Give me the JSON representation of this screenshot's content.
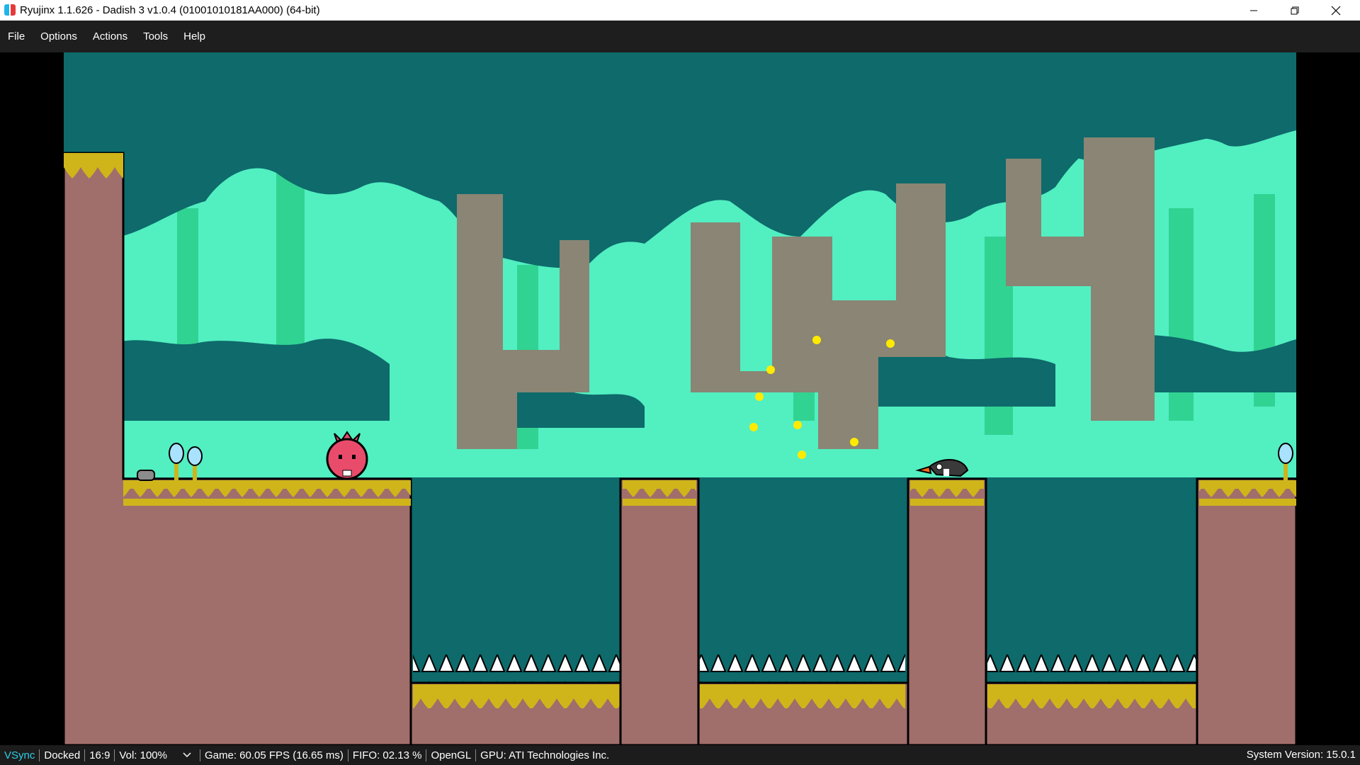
{
  "window": {
    "title": "Ryujinx 1.1.626 - Dadish 3 v1.0.4 (01001010181AA000) (64-bit)",
    "controls": [
      "minimize-icon",
      "restore-icon",
      "close-icon"
    ]
  },
  "menu": {
    "items": [
      {
        "label": "File"
      },
      {
        "label": "Options"
      },
      {
        "label": "Actions"
      },
      {
        "label": "Tools"
      },
      {
        "label": "Help"
      }
    ]
  },
  "status": {
    "vsync": "VSync",
    "docked": "Docked",
    "aspect": "16:9",
    "volume": "Vol: 100%",
    "game_fps": "Game: 60.05 FPS (16.65 ms)",
    "fifo": "FIFO: 02.13 %",
    "backend": "OpenGL",
    "gpu": "GPU: ATI Technologies Inc.",
    "system_version": "System Version: 15.0.1"
  },
  "colors": {
    "sky": "#0e6a6b",
    "leaf_light": "#52efc1",
    "leaf_mid": "#31d392",
    "trunk": "#8a8574",
    "ground": "#a06e6b",
    "grass": "#cfb51a",
    "dadish": "#e94c6b",
    "vsync_accent": "#2ecfe6"
  }
}
